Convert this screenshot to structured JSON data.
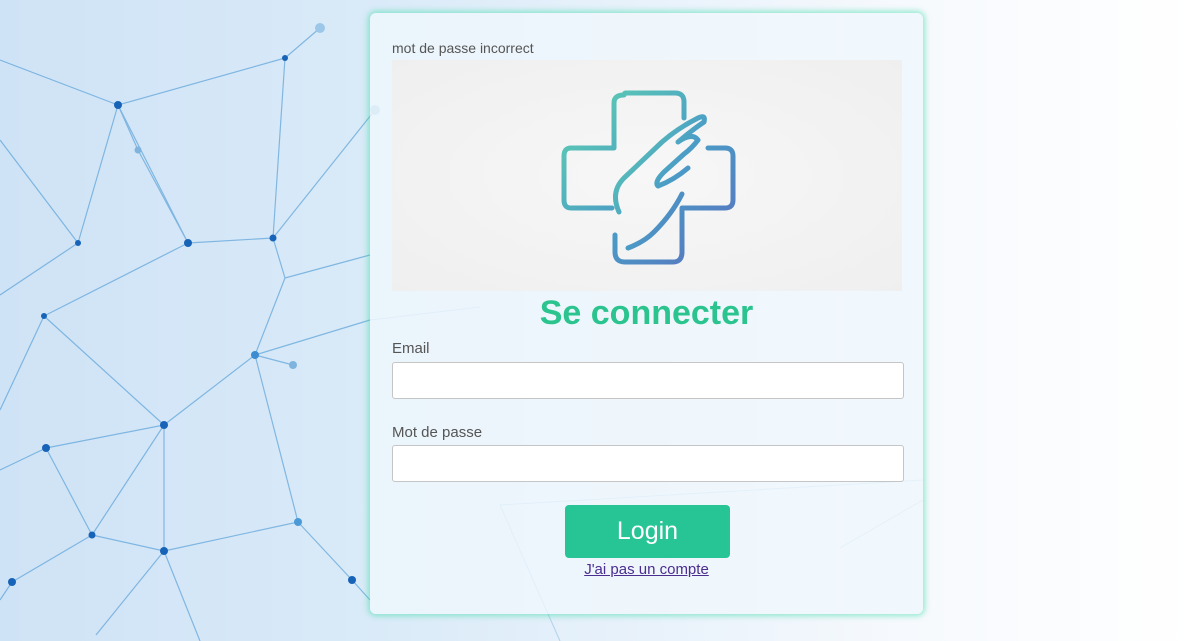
{
  "error": {
    "message": "mot de passe incorrect"
  },
  "logo": {
    "icon": "medical-cross-hand-icon",
    "colors": [
      "#5fd3b0",
      "#4a9cc6",
      "#5a6fc0"
    ]
  },
  "form": {
    "title": "Se connecter",
    "email_label": "Email",
    "email_value": "",
    "password_label": "Mot de passe",
    "password_value": "",
    "login_label": "Login",
    "register_link": "J'ai pas un compte"
  },
  "colors": {
    "accent": "#27c596",
    "title": "#2bc48f",
    "link": "#4b2c8f",
    "card_glow": "#40dcaa"
  }
}
